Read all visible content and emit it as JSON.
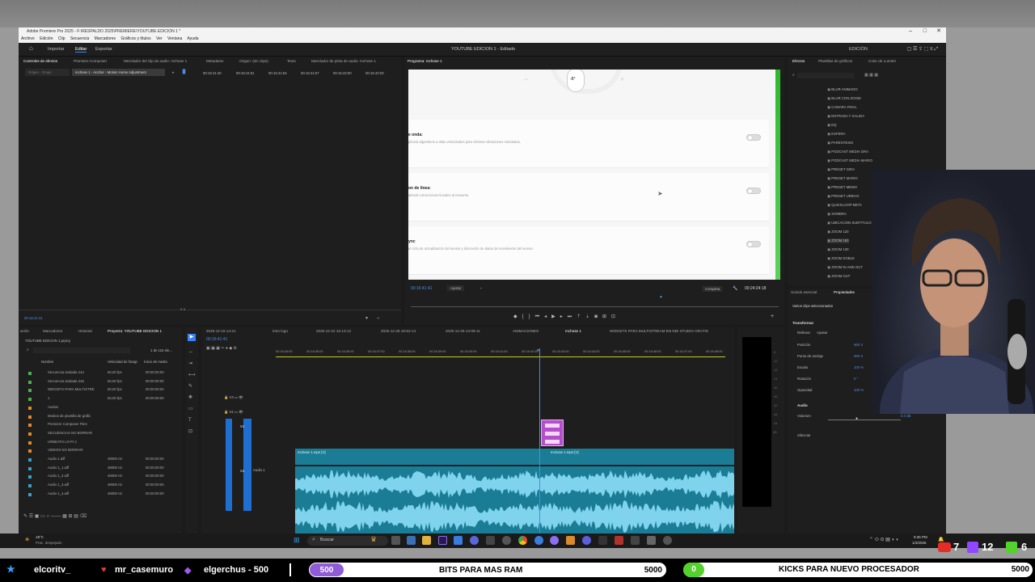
{
  "window": {
    "title": "Adobe Premiere Pro 2025 - F:\\RESPALDO 2025\\PREMIERE\\YOUTUBE EDICION 1 *",
    "menu": [
      "Archivo",
      "Edición",
      "Clip",
      "Secuencia",
      "Marcadores",
      "Gráficos y títulos",
      "Ver",
      "Ventana",
      "Ayuda"
    ],
    "controls": [
      "–",
      "□",
      "✕"
    ]
  },
  "header": {
    "tabs": [
      "Importar",
      "Editar",
      "Exportar"
    ],
    "active_tab": "Editar",
    "center_title": "YOUTUBE EDICION 1 - Editado",
    "right_label": "EDICIÓN"
  },
  "source_panel": {
    "tabs": [
      "Controles de efectos",
      "Premiere Composer",
      "Mezclador del clip de audio: mchose 1",
      "Metadatos",
      "Origen: (sin clips)",
      "Texto",
      "Mezclador de pista de audio: mchose 1"
    ],
    "origin_label": "Origen - Grupo",
    "clip_label": "mchose 1 - Anchor - Motion Horse Adjustment",
    "timecodes": [
      "00:16:41:40",
      "00:16:41:51",
      "00:16:41:54",
      "00:16:41:57",
      "00:16:42:00",
      "00:16:42:03"
    ],
    "current_time": "00:16:41:41"
  },
  "program_monitor": {
    "tab": "Programa: mchose 1",
    "rows": [
      {
        "title": "e onda:",
        "desc": "plicará algoritmos a altas velocidades para eliminar vibraciones onduladas."
      },
      {
        "title": "on de línea:",
        "desc": "alizará correcciones lineales al moverse."
      },
      {
        "title": "ync",
        "desc": "el ciclo de actualización del sensor y discreción de datos de movimiento del sensor."
      }
    ],
    "dial_value": "-5°",
    "dial_minus": "−",
    "dial_plus": "+",
    "timecode": "00:16:41:41",
    "fit": "Ajustar",
    "quality": "Completa",
    "duration": "00:24:24:18"
  },
  "effects_panel": {
    "tabs": [
      "Efectos",
      "Plantillas de gráficos",
      "Color de Lumetri"
    ],
    "items": [
      "BLUR ANIMADO",
      "BLUR CON ZOOM",
      "CAMARA FINAL",
      "ENTRADA Y SALIDA",
      "EQ",
      "ESFERA",
      "PARENTESIS",
      "PODCAST MEDIA GRA",
      "PODCAST MEDIA MARIO",
      "PRESET GIRA",
      "PRESET MARIO",
      "PRESET MEMO",
      "PRESET URBVIC",
      "QUICKLOOP BETA",
      "SOMBRA",
      "UBICACION SUBTITULOS",
      "ZOOM 120",
      "ZOOM 150",
      "ZOOM 130",
      "ZOOM DOBLE",
      "ZOOM IN AND OUT",
      "ZOOM OUT"
    ]
  },
  "properties_panel": {
    "tabs": [
      "Sonido esencial",
      "Propiedades"
    ],
    "selection": "Varios clips seleccionados",
    "transform": "Transformar",
    "buttons": [
      "Rellenar",
      "Ajustar"
    ],
    "fields": [
      {
        "label": "Posición",
        "value": "960 X"
      },
      {
        "label": "Punto de anclaje",
        "value": "960 X"
      },
      {
        "label": "Escala",
        "value": "100 %"
      },
      {
        "label": "Rotación",
        "value": "0 °"
      },
      {
        "label": "Opacidad",
        "value": "100 %"
      }
    ],
    "audio": "Audio",
    "volume": "Volumen",
    "volume_value": "0.0 dB",
    "silence": "Silenciar"
  },
  "project_panel": {
    "tabs": [
      "ación",
      "Marcadores",
      "Historial",
      "Proyecto: YOUTUBE EDICION 1"
    ],
    "project_file": "YOUTUBE EDICION 1.prproj",
    "count": "1 de 116 ele...",
    "columns": [
      "Nombre",
      "Velocidad de fotogr.",
      "Inicio de medio"
    ],
    "rows": [
      {
        "name": "Secuencia anidada 244",
        "fps": "60,00 fps",
        "start": "00:00:00:00"
      },
      {
        "name": "Secuencia anidada 245",
        "fps": "60,00 fps",
        "start": "00:00:00:00"
      },
      {
        "name": "WIDGETS PARA MULTISTRE",
        "fps": "60,00 fps",
        "start": "00:00:00:00"
      },
      {
        "name": "1",
        "fps": "60,00 fps",
        "start": "00:00:00:00"
      },
      {
        "name": "Audios",
        "fps": "",
        "start": ""
      },
      {
        "name": "Medios de plantilla de gráfic",
        "fps": "",
        "start": ""
      },
      {
        "name": "Premiere Composer Files",
        "fps": "",
        "start": ""
      },
      {
        "name": "SECUENCIAS NO BORRAR",
        "fps": "",
        "start": ""
      },
      {
        "name": "URBEATS LO-FI 2",
        "fps": "",
        "start": ""
      },
      {
        "name": "VIDEOS NO BORRAR",
        "fps": "",
        "start": ""
      },
      {
        "name": "Audio 1.aiff",
        "fps": "48000 Hz",
        "start": "00:00:00:00"
      },
      {
        "name": "Audio 1_1.aiff",
        "fps": "48000 Hz",
        "start": "00:00:00:00"
      },
      {
        "name": "Audio 1_2.aiff",
        "fps": "48000 Hz",
        "start": "00:00:00:00"
      },
      {
        "name": "Audio 1_3.aiff",
        "fps": "48000 Hz",
        "start": "00:00:00:00"
      },
      {
        "name": "Audio 1_4.aiff",
        "fps": "48000 Hz",
        "start": "00:00:00:00"
      }
    ]
  },
  "timeline": {
    "tabs": [
      "2025-12-15 14-21",
      "intro logo",
      "2025-12-22 16-13-12",
      "2025-12-28 18-52-14",
      "2025-12-26 13-08-11",
      "ANIMACIONES",
      "mchose 1",
      "WIDGETS PARA MULTISTREAM EN NDI STUDIO GRATIS"
    ],
    "active_tab": "mchose 1",
    "timecode": "00:16:41:41",
    "ruler": [
      "00:16:34:00",
      "00:16:35:00",
      "00:16:36:00",
      "00:16:37:00",
      "00:16:38:00",
      "00:16:39:00",
      "00:16:40:00",
      "00:16:41:00",
      "00:16:42:00",
      "00:16:43:00",
      "00:16:44:00",
      "00:16:45:00",
      "00:16:46:00",
      "00:16:47:00",
      "00:16:48:00"
    ],
    "tracks": [
      "V3",
      "V2",
      "V1",
      "A1"
    ],
    "clip_v1": "mchose 1.mp4 [V]",
    "clip_v1b": "mchose 1.mp4 [V]",
    "audio_track": "Audio 1"
  },
  "taskbar": {
    "weather": "19°C",
    "weather_sub": "Prac. despejado",
    "search": "Buscar",
    "time": "9:36 PM",
    "date": "1/4/2026"
  },
  "stream_bar": {
    "user1": "elcoritv_",
    "user2": "mr_casemuro",
    "user3": "elgerchus - 500",
    "goal1_current": "500",
    "goal1_label": "BITS PARA MAS RAM",
    "goal1_target": "5000",
    "goal2_current": "0",
    "goal2_label": "KICKS PARA NUEVO PROCESADOR",
    "goal2_target": "5000",
    "count_yt": "7",
    "count_twitch": "12",
    "count_kick": "6"
  },
  "colors": {
    "accent": "#3b82f6",
    "track_teal": "#1a7d95",
    "waveform": "#4fb8d9",
    "clip_purple": "#b24fc9",
    "goal_purple": "#8f5bd8",
    "goal_green": "#53d22c"
  }
}
